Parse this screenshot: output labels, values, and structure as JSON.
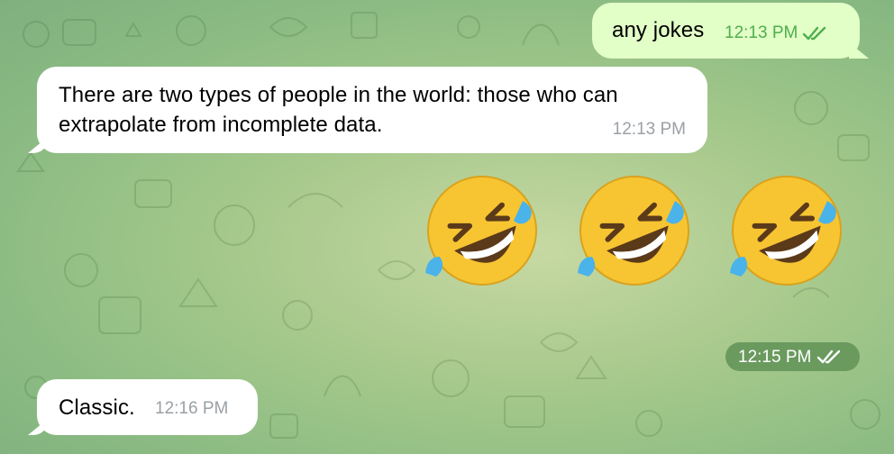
{
  "chat": {
    "messages": [
      {
        "text": "any jokes",
        "time": "12:13 PM",
        "status": "read"
      },
      {
        "text": "There are two types of people in the world: those who can extrapolate from incomplete data.",
        "time": "12:13 PM"
      },
      {
        "emoji": [
          "🤣",
          "🤣",
          "🤣"
        ],
        "time": "12:15 PM",
        "status": "read"
      },
      {
        "text": "Classic.",
        "time": "12:16 PM"
      }
    ]
  },
  "colors": {
    "outgoing_bubble": "#e2ffc7",
    "incoming_bubble": "#ffffff",
    "outgoing_time": "#4fae4e",
    "pill_bg": "#6a9a5e",
    "wallpaper": "#9cc38a"
  },
  "icons": {
    "read_receipt": "double-check-icon",
    "emoji_name": "rolling-on-the-floor-laughing"
  }
}
